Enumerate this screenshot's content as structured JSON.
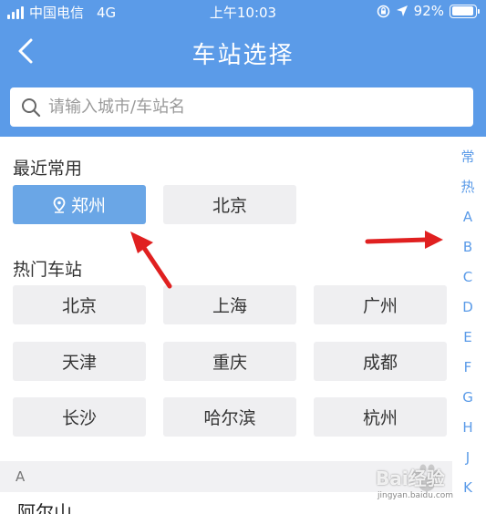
{
  "status_bar": {
    "carrier": "中国电信",
    "network": "4G",
    "time": "上午10:03",
    "battery": "92%"
  },
  "nav": {
    "title": "车站选择"
  },
  "search": {
    "placeholder": "请输入城市/车站名"
  },
  "recent": {
    "title": "最近常用",
    "items": [
      {
        "label": "郑州",
        "active": true
      },
      {
        "label": "北京",
        "active": false
      }
    ]
  },
  "hot": {
    "title": "热门车站",
    "items": [
      "北京",
      "上海",
      "广州",
      "天津",
      "重庆",
      "成都",
      "长沙",
      "哈尔滨",
      "杭州"
    ]
  },
  "list": {
    "header": "A",
    "first_city": "阿尔山"
  },
  "index_bar": [
    "常",
    "热",
    "A",
    "B",
    "C",
    "D",
    "E",
    "F",
    "G",
    "H",
    "J",
    "K"
  ],
  "watermark": {
    "text": "Bai经验",
    "url": "jingyan.baidu.com"
  },
  "colors": {
    "primary": "#5b9be8",
    "active_button": "#6aa6e6",
    "button_bg": "#efeff1",
    "annotation_arrow": "#e02020"
  }
}
